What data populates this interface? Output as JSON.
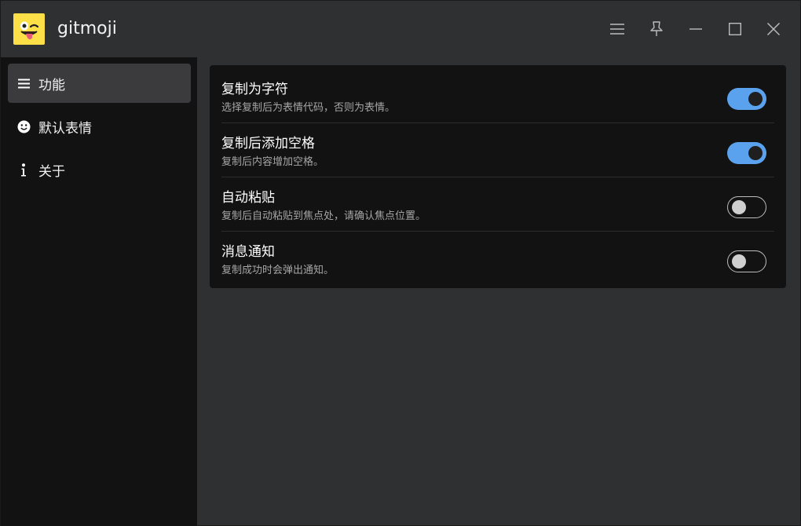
{
  "app": {
    "title": "gitmoji",
    "logo_icon": "winking-tongue-face-emoji",
    "logo_color": "#fde047"
  },
  "titlebar": {
    "buttons": [
      "menu-icon",
      "pin-icon",
      "minimize-icon",
      "maximize-icon",
      "close-icon"
    ]
  },
  "sidebar": {
    "items": [
      {
        "label": "功能",
        "icon": "list-icon",
        "active": true
      },
      {
        "label": "默认表情",
        "icon": "smiley-icon",
        "active": false
      },
      {
        "label": "关于",
        "icon": "info-icon",
        "active": false
      }
    ]
  },
  "settings": [
    {
      "title": "复制为字符",
      "desc": "选择复制后为表情代码，否则为表情。",
      "enabled": true
    },
    {
      "title": "复制后添加空格",
      "desc": "复制后内容增加空格。",
      "enabled": true
    },
    {
      "title": "自动粘贴",
      "desc": "复制后自动粘贴到焦点处，请确认焦点位置。",
      "enabled": false
    },
    {
      "title": "消息通知",
      "desc": "复制成功时会弹出通知。",
      "enabled": false
    }
  ],
  "colors": {
    "accent": "#5aa2ee",
    "sidebar_bg": "#121212",
    "window_bg": "#2f3032",
    "card_bg": "#121212"
  }
}
